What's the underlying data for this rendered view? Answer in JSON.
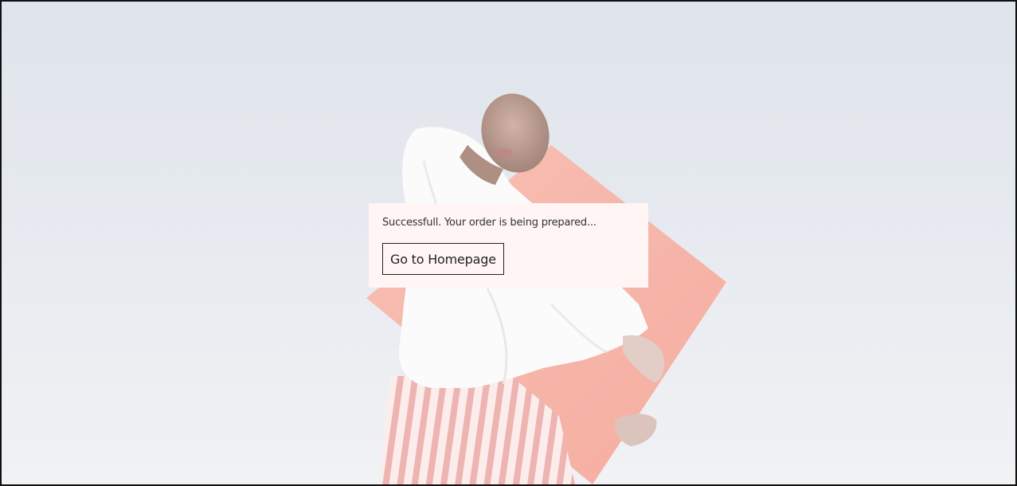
{
  "page": {
    "background_image": "model-holding-coral-square-against-sky"
  },
  "dialog": {
    "message": "Successfull. Your order is being prepared...",
    "button_label": "Go to Homepage"
  },
  "colors": {
    "sky": "#dde2ea",
    "coral": "#f4a596",
    "dialog_bg": "#fff5f5",
    "text": "#333333",
    "button_border": "#222222"
  }
}
